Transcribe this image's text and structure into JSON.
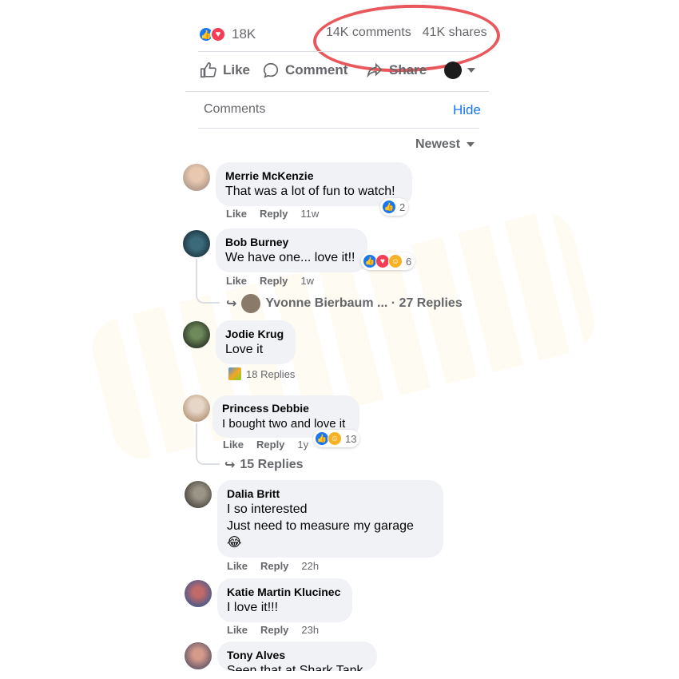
{
  "post": {
    "reaction_count": "18K",
    "comments_count": "14K comments",
    "shares_count": "41K shares"
  },
  "actions": {
    "like": "Like",
    "comment": "Comment",
    "share": "Share"
  },
  "comments_section": {
    "title": "Comments",
    "hide": "Hide",
    "sort": "Newest"
  },
  "comments": [
    {
      "author": "Merrie McKenzie",
      "text": "That was a lot of fun to watch!",
      "like": "Like",
      "reply": "Reply",
      "time": "11w",
      "reactions": "2"
    },
    {
      "author": "Bob Burney",
      "text": "We have one... love it!!",
      "like": "Like",
      "reply": "Reply",
      "time": "1w",
      "reactions": "6",
      "replies": "Yvonne Bierbaum ... · 27 Replies"
    },
    {
      "author": "Jodie Krug",
      "text": "Love it",
      "reactions_label": "18 Replies"
    },
    {
      "author": "Princess Debbie",
      "text": "I bought two and love it",
      "like": "Like",
      "reply": "Reply",
      "time": "1y",
      "reactions": "13",
      "replies": "15 Replies"
    },
    {
      "author": "Dalia Britt",
      "text_lines": [
        "I so interested",
        "Just need to measure my garage",
        "😂"
      ],
      "like": "Like",
      "reply": "Reply",
      "time": "22h"
    },
    {
      "author": "Katie Martin Klucinec",
      "text": "I love it!!!",
      "like": "Like",
      "reply": "Reply",
      "time": "23h"
    },
    {
      "author": "Tony Alves",
      "text": "Seen that at Shark Tank"
    }
  ],
  "colors": {
    "accent": "#1877f2",
    "love": "#f33e58",
    "highlight_circle": "#e8585c"
  }
}
